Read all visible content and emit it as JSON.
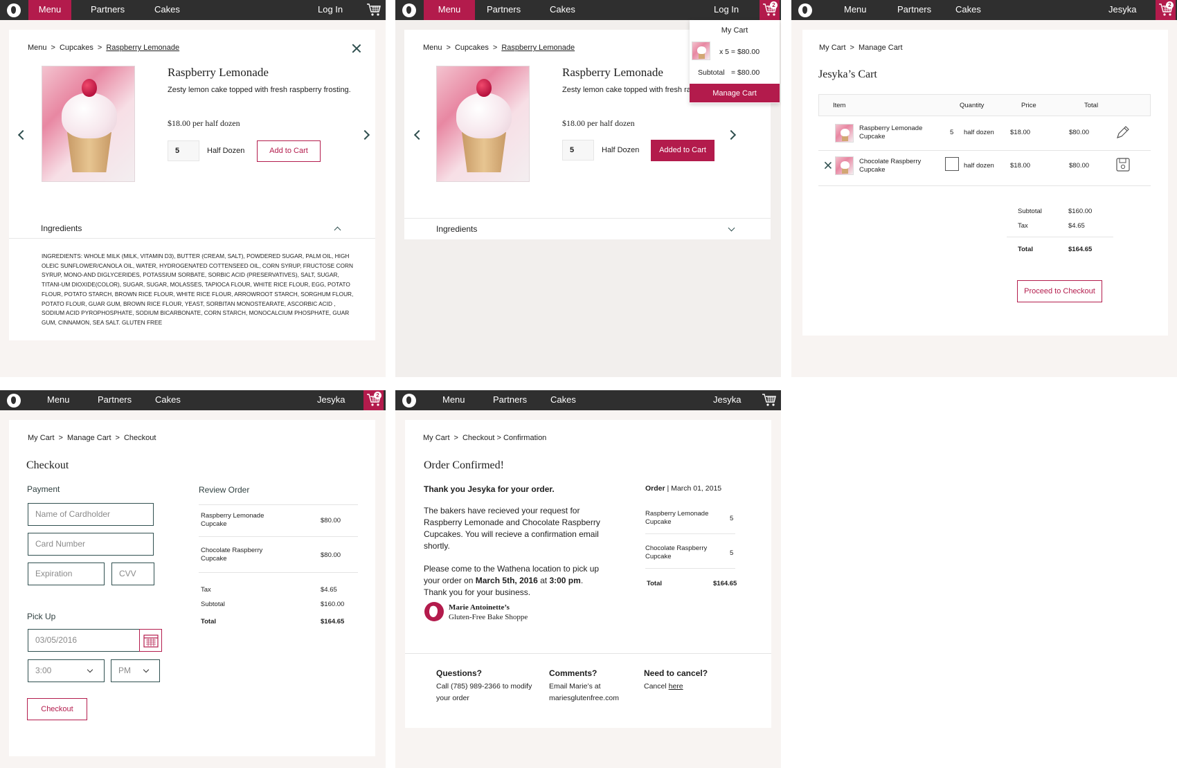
{
  "colors": {
    "accent": "#b31b4c",
    "nav": "#2f2f2f"
  },
  "nav": {
    "menu": "Menu",
    "partners": "Partners",
    "cakes": "Cakes",
    "login": "Log In",
    "user": "Jesyka",
    "cart_count": "2"
  },
  "product": {
    "breadcrumb": {
      "menu": "Menu",
      "cupcakes": "Cupcakes",
      "current": "Raspberry Lemonade"
    },
    "title": "Raspberry Lemonade",
    "description": "Zesty lemon cake topped with fresh raspberry frosting.",
    "description_truncated": "Zesty lemon cake topped with fresh ra",
    "price": "$18.00 per half dozen",
    "quantity": "5",
    "unit": "Half Dozen",
    "add_label": "Add to Cart",
    "added_label": "Added to Cart",
    "ingredients_label": "Ingredients",
    "ingredients_text": "INGREDIENTS: WHOLE MILK (MILK, VITAMIN D3), BUTTER (CREAM, SALT), POWDERED SUGAR, PALM OIL, HIGH OLEIC SUNFLOWER/CANOLA OIL, WATER, HYDROGENATED COTTENSEED OIL, CORN SYRUP, FRUCTOSE CORN SYRUP, MONO-AND DIGLYCERIDES, POTASSIUM SORBATE, SORBIC ACID (PRESERVATIVES), SALT, SUGAR, TITANI-UM DIOXIDE(COLOR), SUGAR, SUGAR, MOLASSES, TAPIOCA FLOUR, WHITE RICE FLOUR, EGG, POTATO FLOUR, POTATO STARCH, BROWN RICE FLOUR, WHITE RICE FLOUR, ARROWROOT STARCH, SORGHUM FLOUR, POTATO FLOUR, GUAR GUM, BROWN RICE FLOUR, YEAST, SORBITAN MONOSTEARATE, ASCORBIC ACID , SODIUM ACID PYROPHOSPHATE, SODIUM BICARBONATE, CORN STARCH, MONOCALCIUM PHOSPHATE, GUAR GUM, CINNAMON, SEA SALT. GLUTEN FREE"
  },
  "mini_cart": {
    "title": "My Cart",
    "line": "x  5 = $80.00",
    "subtotal_label": "Subtotal",
    "subtotal_value": "= $80.00",
    "manage": "Manage Cart"
  },
  "manage_cart": {
    "breadcrumb": {
      "a": "My Cart",
      "b": "Manage Cart"
    },
    "title": "Jesyka’s Cart",
    "headers": {
      "item": "Item",
      "quantity": "Quantity",
      "price": "Price",
      "total": "Total"
    },
    "rows": [
      {
        "name": "Raspberry Lemonade Cupcake",
        "qty": "5",
        "unit": "half dozen",
        "price": "$18.00",
        "total": "$80.00"
      },
      {
        "name": "Chocolate Raspberry Cupcake",
        "qty": "",
        "unit": "half dozen",
        "price": "$18.00",
        "total": "$80.00"
      }
    ],
    "subtotal_label": "Subtotal",
    "subtotal": "$160.00",
    "tax_label": "Tax",
    "tax": "$4.65",
    "total_label": "Total",
    "total": "$164.65",
    "checkout_label": "Proceed to Checkout"
  },
  "checkout": {
    "breadcrumb": {
      "a": "My Cart",
      "b": "Manage Cart",
      "c": "Checkout"
    },
    "title": "Checkout",
    "payment_label": "Payment",
    "name_placeholder": "Name of Cardholder",
    "card_placeholder": "Card Number",
    "exp_placeholder": "Expiration",
    "cvv_placeholder": "CVV",
    "pickup_label": "Pick Up",
    "date_value": "03/05/2016",
    "time_value": "3:00",
    "ampm_value": "PM",
    "submit_label": "Checkout",
    "review_label": "Review Order",
    "items": [
      {
        "name": "Raspberry Lemonade Cupcake",
        "price": "$80.00"
      },
      {
        "name": "Chocolate Raspberry Cupcake",
        "price": "$80.00"
      }
    ],
    "tax_label": "Tax",
    "tax": "$4.65",
    "subtotal_label": "Subtotal",
    "subtotal": "$160.00",
    "total_label": "Total",
    "total": "$164.65"
  },
  "confirmation": {
    "breadcrumb": {
      "a": "My Cart",
      "b": "Checkout > Confirmation"
    },
    "title": "Order Confirmed!",
    "thanks": "Thank you Jesyka for your order.",
    "para1": "The bakers have recieved your request for Raspberry Lemonade and Chocolate Raspberry Cupcakes. You will recieve a confirmation email shortly.",
    "para2_a": "Please come to the Wathena location to pick up your order on ",
    "para2_date": "March 5th, 2016",
    "para2_at": " at ",
    "para2_time": "3:00 pm",
    "para2_b": ". Thank you for your business.",
    "order_label": "Order",
    "order_date": "March 01, 2015",
    "items": [
      {
        "name": "Raspberry Lemonade Cupcake",
        "qty": "5"
      },
      {
        "name": "Chocolate Raspberry Cupcake",
        "qty": "5"
      }
    ],
    "total_label": "Total",
    "total": "$164.65",
    "brand_line1": "Marie Antoinette’s",
    "brand_line2": "Gluten-Free Bake Shoppe",
    "questions_title": "Questions?",
    "questions_text": "Call  (785) 989-2366  to modify your order",
    "comments_title": "Comments?",
    "comments_text1": "Email Marie’s at",
    "comments_text2": "mariesglutenfree.com",
    "cancel_title": "Need to cancel?",
    "cancel_text": "Cancel ",
    "cancel_link": "here"
  }
}
